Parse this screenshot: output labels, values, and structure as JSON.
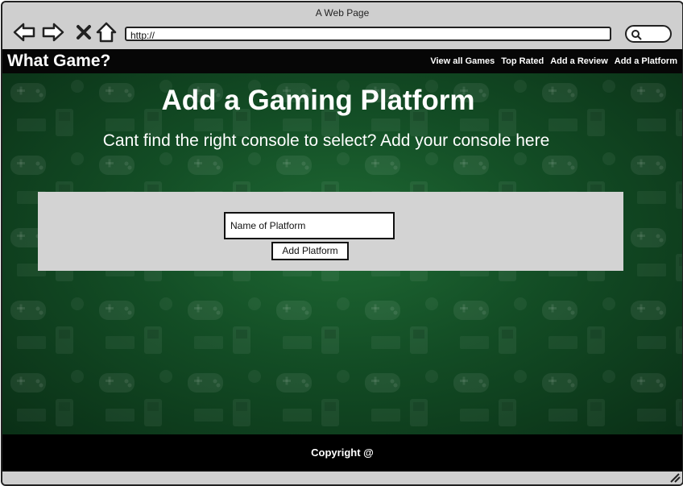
{
  "browser": {
    "title": "A Web Page",
    "url": "http://",
    "icons": [
      "back-arrow-icon",
      "forward-arrow-icon",
      "close-x-icon",
      "home-icon",
      "search-icon"
    ]
  },
  "navbar": {
    "brand": "What Game?",
    "links": [
      "View all Games",
      "Top Rated",
      "Add a Review",
      "Add a Platform"
    ]
  },
  "hero": {
    "title": "Add a Gaming Platform",
    "subtitle": "Cant find the right console to select? Add your console here"
  },
  "form": {
    "input_value": "Name of Platform",
    "button_label": "Add Platform"
  },
  "footer": {
    "copyright": "Copyright @"
  },
  "colors": {
    "background_green": "#134d25",
    "navbar": "#060606",
    "panel": "#d3d3d3"
  }
}
